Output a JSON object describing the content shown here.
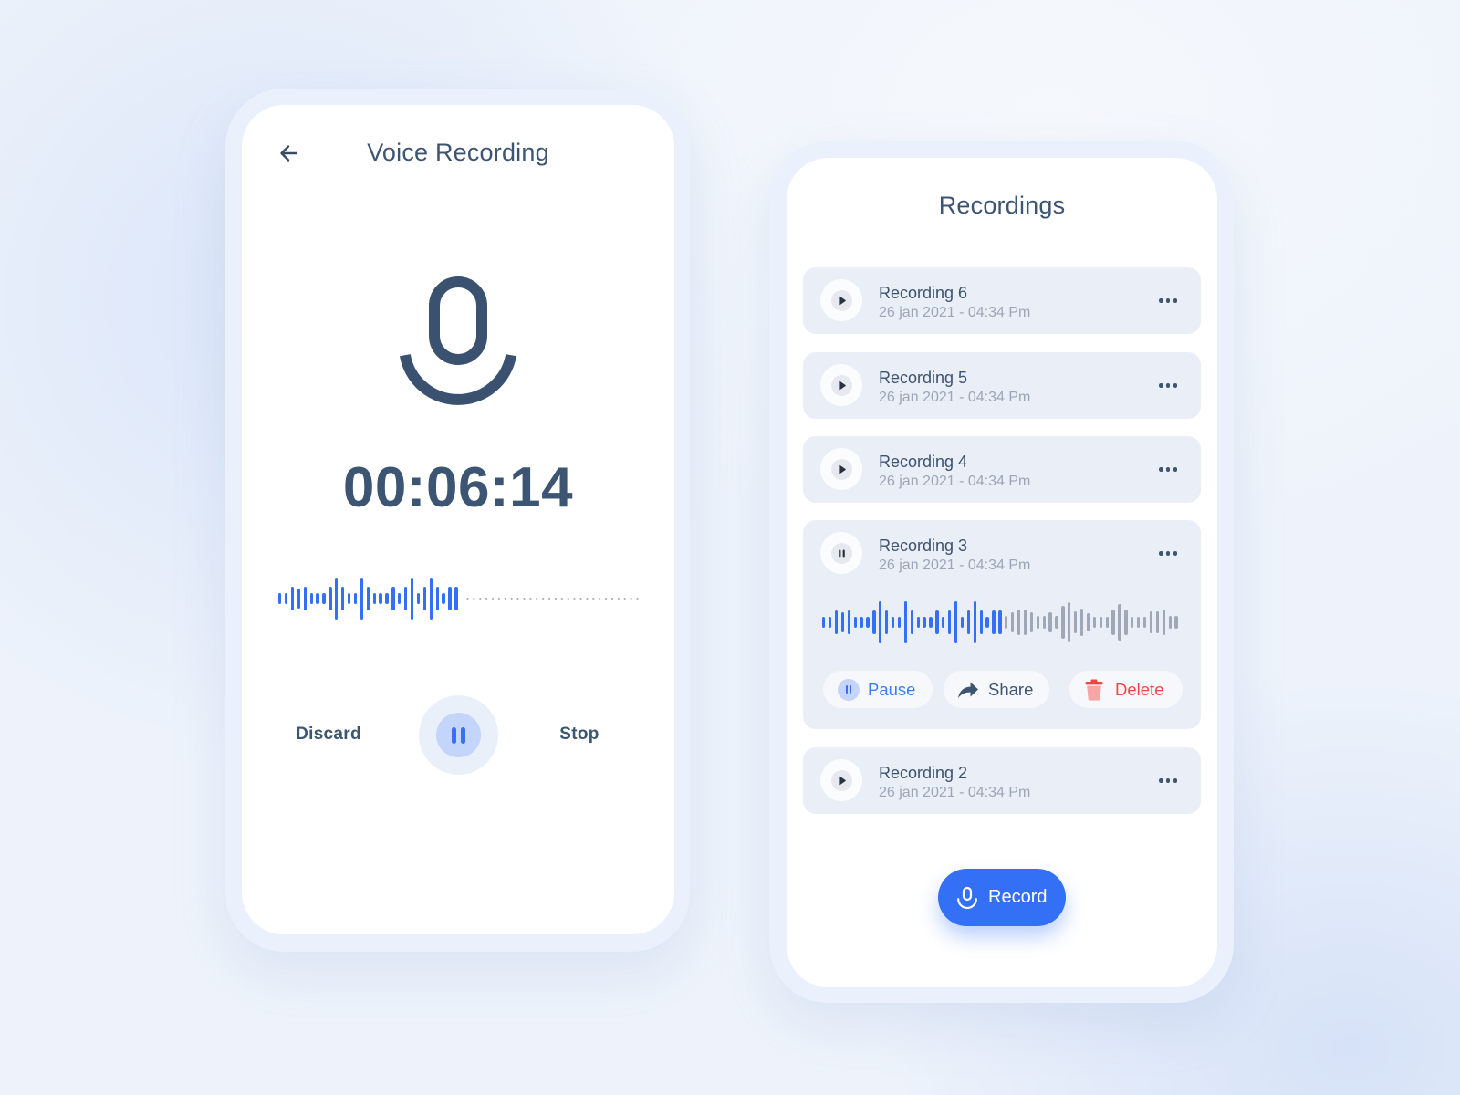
{
  "colors": {
    "accent": "#3370f5",
    "text_primary": "#3b5270",
    "text_secondary": "#9ca6b6",
    "danger": "#f04646",
    "card_background": "#eaeef6",
    "waveform_unplayed": "#a0a7b7"
  },
  "voice_recording_screen": {
    "back_icon": "arrow-left-icon",
    "title": "Voice Recording",
    "mic_icon": "microphone-icon",
    "timer": "00:06:14",
    "waveform": {
      "state": "recording",
      "amplitudes": [
        0.26,
        0.26,
        0.55,
        0.48,
        0.55,
        0.26,
        0.26,
        0.26,
        0.55,
        1.0,
        0.55,
        0.26,
        0.26,
        1.0,
        0.55,
        0.26,
        0.26,
        0.26,
        0.55,
        0.26,
        0.55,
        1.0,
        0.26,
        0.55,
        1.0,
        0.55,
        0.26,
        0.55,
        0.55
      ]
    },
    "controls": {
      "discard_label": "Discard",
      "pause_icon": "pause-icon",
      "stop_label": "Stop"
    }
  },
  "recordings_screen": {
    "title": "Recordings",
    "recordings": [
      {
        "title": "Recording 6",
        "date": "26 jan 2021 - 04:34 Pm",
        "button_icon": "play-icon",
        "more_icon": "more-horizontal-icon",
        "expanded": false
      },
      {
        "title": "Recording 5",
        "date": "26 jan 2021 - 04:34 Pm",
        "button_icon": "play-icon",
        "more_icon": "more-horizontal-icon",
        "expanded": false
      },
      {
        "title": "Recording 4",
        "date": "26 jan 2021 - 04:34 Pm",
        "button_icon": "play-icon",
        "more_icon": "more-horizontal-icon",
        "expanded": false
      },
      {
        "title": "Recording 3",
        "date": "26 jan 2021 - 04:34 Pm",
        "button_icon": "pause-icon",
        "more_icon": "more-horizontal-icon",
        "expanded": true,
        "waveform": {
          "played_amplitudes": [
            0.26,
            0.26,
            0.55,
            0.48,
            0.55,
            0.26,
            0.26,
            0.26,
            0.55,
            1.0,
            0.55,
            0.26,
            0.26,
            1.0,
            0.55,
            0.26,
            0.26,
            0.26,
            0.55,
            0.26,
            0.55,
            1.0,
            0.26,
            0.55,
            1.0,
            0.55,
            0.26,
            0.55,
            0.55
          ],
          "remaining_amplitudes": [
            0.3,
            0.48,
            0.6,
            0.6,
            0.48,
            0.3,
            0.3,
            0.48,
            0.3,
            0.78,
            0.96,
            0.52,
            0.65,
            0.43,
            0.26,
            0.26,
            0.26,
            0.6,
            0.87,
            0.6,
            0.26,
            0.26,
            0.26,
            0.52,
            0.52,
            0.6,
            0.3,
            0.3
          ]
        },
        "actions": [
          {
            "label": "Pause",
            "icon": "pause-icon"
          },
          {
            "label": "Share",
            "icon": "share-icon"
          },
          {
            "label": "Delete",
            "icon": "trash-icon"
          }
        ]
      },
      {
        "title": "Recording 2",
        "date": "26 jan 2021 - 04:34 Pm",
        "button_icon": "play-icon",
        "more_icon": "more-horizontal-icon",
        "expanded": false
      }
    ],
    "record_button": {
      "label": "Record",
      "icon": "microphone-icon"
    }
  }
}
